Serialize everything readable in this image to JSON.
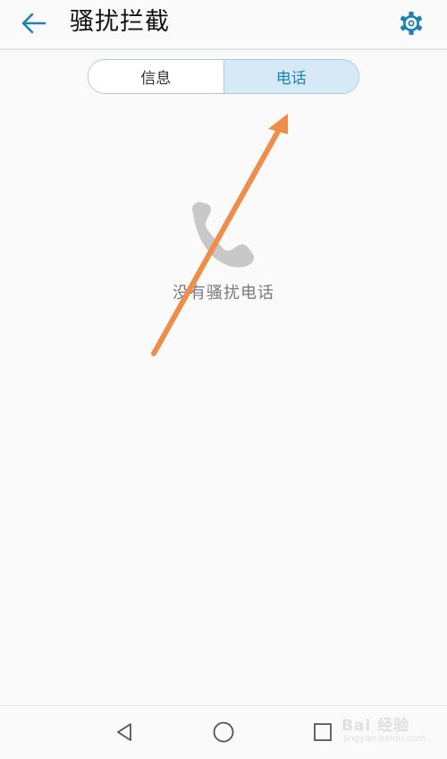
{
  "header": {
    "title": "骚扰拦截",
    "back_icon": "arrow-left-icon",
    "settings_icon": "gear-icon"
  },
  "tabs": [
    {
      "label": "信息",
      "selected": false
    },
    {
      "label": "电话",
      "selected": true
    }
  ],
  "empty_state": {
    "icon": "phone-handset-icon",
    "text": "没有骚扰电话"
  },
  "nav_bar": {
    "back_icon": "triangle-back-icon",
    "home_icon": "circle-home-icon",
    "recents_icon": "square-recents-icon"
  },
  "watermark": {
    "main": "Bai 经验",
    "sub": "jingyan.baidu.com"
  },
  "colors": {
    "accent": "#1f7fb8",
    "tab_selected_bg": "#d6e9f6",
    "annotation_arrow": "#ee8e4a",
    "icon_gray": "#c8c8c8"
  }
}
